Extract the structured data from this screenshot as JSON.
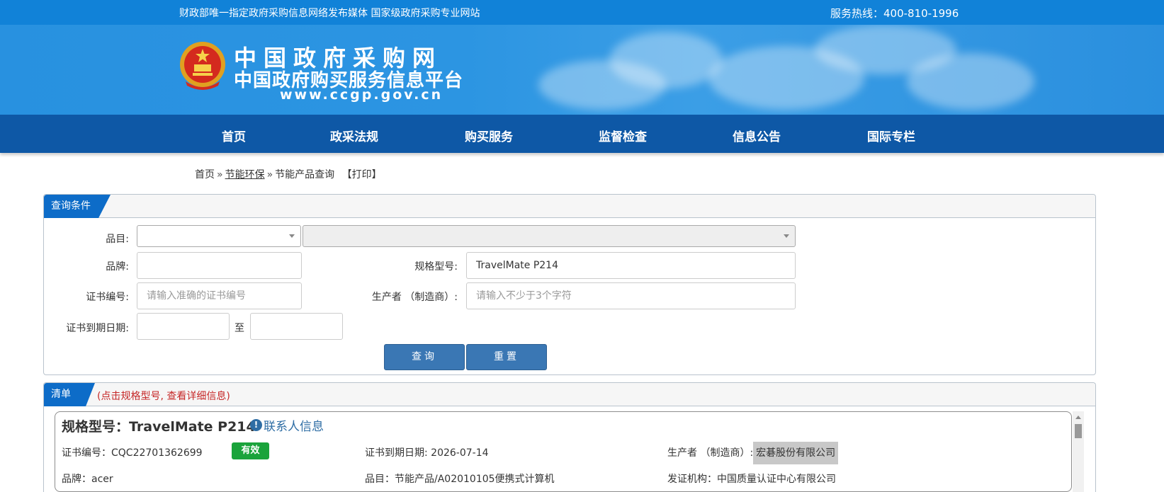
{
  "topbar": {
    "slogan": "财政部唯一指定政府采购信息网络发布媒体 国家级政府采购专业网站",
    "hotline": "服务热线：400-810-1996"
  },
  "banner": {
    "site_name": "中国政府采购网",
    "platform_name": "中国政府购买服务信息平台",
    "url": "www.ccgp.gov.cn"
  },
  "nav": {
    "items": [
      "首页",
      "政采法规",
      "购买服务",
      "监督检查",
      "信息公告",
      "国际专栏"
    ]
  },
  "breadcrumb": {
    "home": "首页",
    "sep": "»",
    "section": "节能环保",
    "current": "节能产品查询",
    "print": "【打印】"
  },
  "query": {
    "tab": "查询条件",
    "category_label": "品目:",
    "category_value": "",
    "subcategory_value": "",
    "brand_label": "品牌:",
    "brand_value": "",
    "model_label": "规格型号:",
    "model_value": "TravelMate P214",
    "cert_no_label": "证书编号:",
    "cert_no_placeholder": "请输入准确的证书编号",
    "maker_label": "生产者 （制造商）:",
    "maker_placeholder": "请输入不少于3个字符",
    "expiry_label": "证书到期日期:",
    "expiry_to": "至",
    "search_button": "查询",
    "reset_button": "重置"
  },
  "results": {
    "tab": "清单",
    "hint": "(点击规格型号, 查看详细信息)",
    "items": [
      {
        "model_title": "规格型号：TravelMate P214",
        "contact_link": "联系人信息",
        "cert_no": "证书编号：CQC22701362699",
        "status": "有效",
        "expiry": "证书到期日期: 2026-07-14",
        "maker_label": "生产者 （制造商）:",
        "maker_value": "宏碁股份有限公司",
        "brand": "品牌：acer",
        "category": "品目：节能产品/A02010105便携式计算机",
        "issuer": "发证机构：中国质量认证中心有限公司"
      }
    ]
  },
  "colors": {
    "topbar": "#1182d8",
    "nav": "#0e58a6",
    "tab": "#0d6cc8",
    "button": "#3a77b4",
    "valid_badge": "#1aa33b",
    "hint": "#c62828"
  }
}
